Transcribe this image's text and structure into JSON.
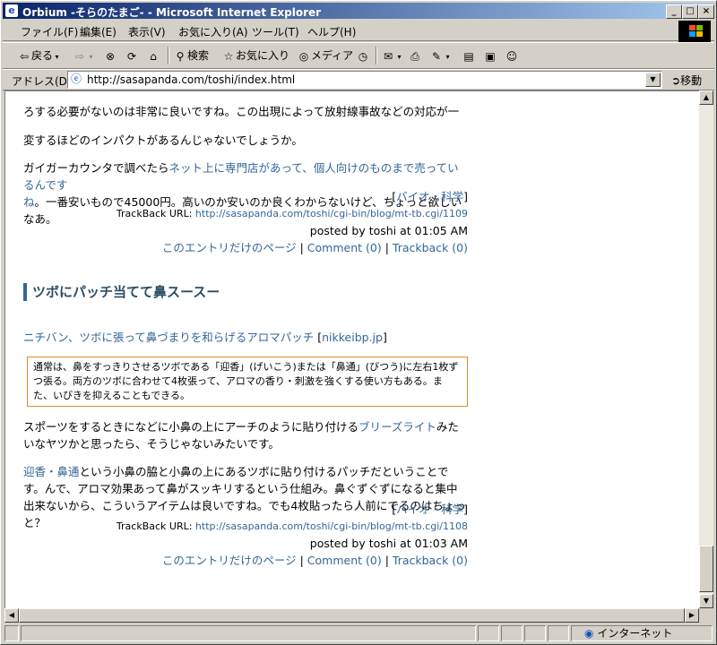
{
  "window": {
    "title": "Orbium -そらのたまご- - Microsoft Internet Explorer",
    "icon": "ie-icon",
    "minimize": "_",
    "maximize": "□",
    "close": "×"
  },
  "menu": {
    "items": [
      "ファイル(F)",
      "編集(E)",
      "表示(V)",
      "お気に入り(A)",
      "ツール(T)",
      "ヘルプ(H)"
    ]
  },
  "toolbar": {
    "back": "戻る",
    "search": "検索",
    "favorites": "お気に入り",
    "media": "メディア"
  },
  "address": {
    "label": "アドレス(D)",
    "url": "http://sasapanda.com/toshi/index.html",
    "go": "移動"
  },
  "entry1": {
    "line_partial": "ろする必要がないのは非常に良いですね。この出現によって放射線事故などの対応が一",
    "line2": "変するほどのインパクトがあるんじゃないでしょうか。",
    "line3_pre": "ガイガーカウンタで調べたら",
    "line3_link": "ネット上に専門店があって、個人向けのものまで売っているんです",
    "line4_link": "ね",
    "line4_post": "。一番安いもので45000円。高いのか安いのか良くわからないけど、ちょっと欲しいなあ。",
    "category": "バイオ・科学",
    "trackback_label": "TrackBack URL:",
    "trackback_url": "http://sasapanda.com/toshi/cgi-bin/blog/mt-tb.cgi/1109",
    "posted": "posted by toshi at 01:05 AM",
    "link_entry": "このエントリだけのページ",
    "link_comment": "Comment (0)",
    "link_trackback": "Trackback (0)"
  },
  "entry2": {
    "title": "ツボにパッチ当てて鼻スースー",
    "source_link": "ニチバン、ツボに張って鼻づまりを和らげるアロマパッチ",
    "source_site": "nikkeibp.jp",
    "quote": "通常は、鼻をすっきりさせるツボである「迎香」(げいこう)または「鼻通」(びつう)に左右1枚ずつ張る。両方のツボに合わせて4枚張って、アロマの香り・刺激を強くする使い方もある。また、いびきを抑えることもできる。",
    "p1_pre": "スポーツをするときになどに小鼻の上にアーチのように貼り付ける",
    "p1_link": "ブリーズライト",
    "p1_post": "みたいなヤツかと思ったら、そうじゃないみたいです。",
    "p2_link": "迎香・鼻通",
    "p2_post": "という小鼻の脇と小鼻の上にあるツボに貼り付けるパッチだということです。んで、アロマ効果あって鼻がスッキリするという仕組み。鼻ぐずぐずになると集中出来ないから、こういうアイテムは良いですね。でも4枚貼ったら人前にでるのはちょっと？",
    "category": "バイオ・科学",
    "trackback_label": "TrackBack URL:",
    "trackback_url": "http://sasapanda.com/toshi/cgi-bin/blog/mt-tb.cgi/1108",
    "posted": "posted by toshi at 01:03 AM",
    "link_entry": "このエントリだけのページ",
    "link_comment": "Comment (0)",
    "link_trackback": "Trackback (0)"
  },
  "status": {
    "zone": "インターネット"
  },
  "colors": {
    "link": "#336699",
    "title_bar_start": "#0a246a",
    "quote_border": "#e08a30"
  }
}
